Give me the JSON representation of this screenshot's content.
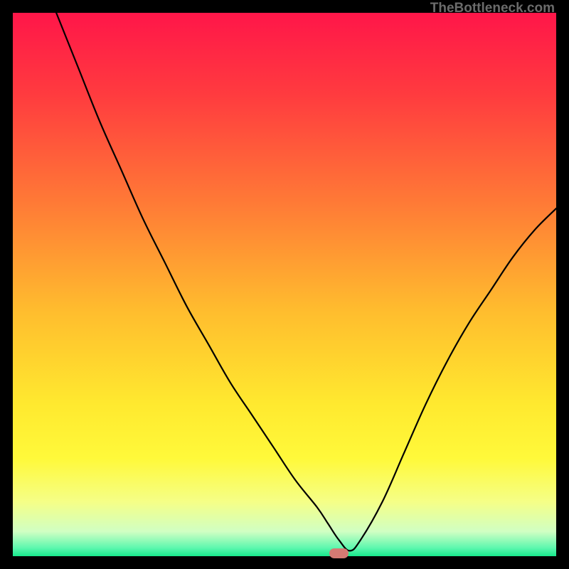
{
  "watermark": "TheBottleneck.com",
  "chart_data": {
    "type": "line",
    "title": "",
    "xlabel": "",
    "ylabel": "",
    "xlim": [
      0,
      100
    ],
    "ylim": [
      0,
      100
    ],
    "series": [
      {
        "name": "bottleneck-curve",
        "x": [
          8,
          12,
          16,
          20,
          24,
          28,
          32,
          36,
          40,
          44,
          48,
          52,
          56,
          58,
          60,
          62,
          64,
          68,
          72,
          76,
          80,
          84,
          88,
          92,
          96,
          100
        ],
        "y": [
          100,
          90,
          80,
          71,
          62,
          54,
          46,
          39,
          32,
          26,
          20,
          14,
          9,
          6,
          3,
          1,
          3,
          10,
          19,
          28,
          36,
          43,
          49,
          55,
          60,
          64
        ]
      }
    ],
    "marker": {
      "x": 60,
      "y": 0.5,
      "width": 3.5,
      "height": 1.8
    },
    "gradient_stops": [
      {
        "pos": 0.0,
        "color": "#ff1649"
      },
      {
        "pos": 0.15,
        "color": "#ff3b3f"
      },
      {
        "pos": 0.35,
        "color": "#ff7a36"
      },
      {
        "pos": 0.55,
        "color": "#ffbd2e"
      },
      {
        "pos": 0.72,
        "color": "#ffe92f"
      },
      {
        "pos": 0.82,
        "color": "#fff93a"
      },
      {
        "pos": 0.9,
        "color": "#f5ff87"
      },
      {
        "pos": 0.955,
        "color": "#d0ffc3"
      },
      {
        "pos": 0.985,
        "color": "#5cf7ae"
      },
      {
        "pos": 1.0,
        "color": "#17e98b"
      }
    ]
  }
}
